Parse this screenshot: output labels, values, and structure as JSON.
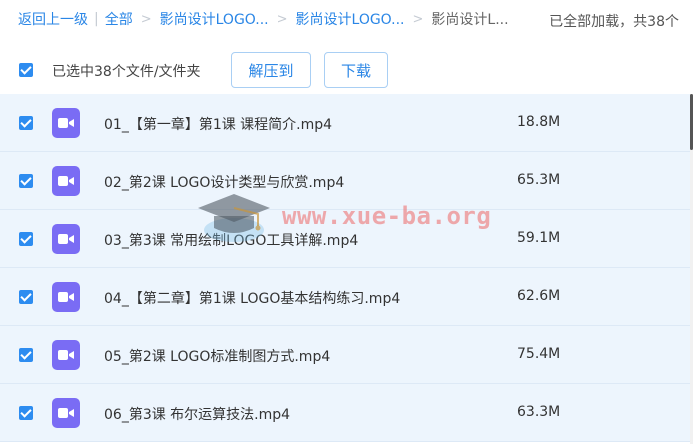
{
  "breadcrumb": {
    "back": "返回上一级",
    "root": "全部",
    "level1": "影尚设计LOGO...",
    "level2": "影尚设计LOGO...",
    "current": "影尚设计L...",
    "status": "已全部加载，共38个"
  },
  "toolbar": {
    "selected_label": "已选中38个文件/文件夹",
    "unzip_label": "解压到",
    "download_label": "下载"
  },
  "files": [
    {
      "name": "01_【第一章】第1课 课程简介.mp4",
      "size": "18.8M",
      "checked": true
    },
    {
      "name": "02_第2课 LOGO设计类型与欣赏.mp4",
      "size": "65.3M",
      "checked": true
    },
    {
      "name": "03_第3课 常用绘制LOGO工具详解.mp4",
      "size": "59.1M",
      "checked": true
    },
    {
      "name": "04_【第二章】第1课 LOGO基本结构练习.mp4",
      "size": "62.6M",
      "checked": true
    },
    {
      "name": "05_第2课 LOGO标准制图方式.mp4",
      "size": "75.4M",
      "checked": true
    },
    {
      "name": "06_第3课 布尔运算技法.mp4",
      "size": "63.3M",
      "checked": true
    }
  ],
  "watermark": {
    "text": "www.xue-ba.org"
  },
  "colors": {
    "accent": "#2a86e6",
    "row_bg": "#edf5fd",
    "video_icon": "#7a6cf4",
    "checkbox": "#2d8cf0"
  }
}
